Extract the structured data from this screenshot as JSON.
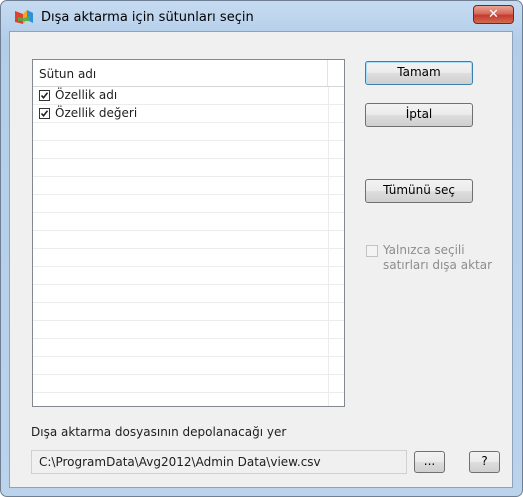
{
  "window": {
    "title": "Dışa aktarma için sütunları seçin",
    "close_glyph": "✕",
    "app_icon": "avg-logo-icon"
  },
  "columns_list": {
    "header": "Sütun adı",
    "items": [
      {
        "label": "Özellik adı",
        "checked": true
      },
      {
        "label": "Özellik değeri",
        "checked": true
      }
    ]
  },
  "buttons": {
    "ok": "Tamam",
    "cancel": "İptal",
    "select_all": "Tümünü seç",
    "browse": "...",
    "help": "?"
  },
  "selected_rows_only": {
    "label": "Yalnızca seçili satırları dışa aktar",
    "checked": false,
    "enabled": false
  },
  "export_path": {
    "caption": "Dışa aktarma dosyasının depolanacağı yer",
    "value": "C:\\ProgramData\\Avg2012\\Admin Data\\view.csv"
  }
}
